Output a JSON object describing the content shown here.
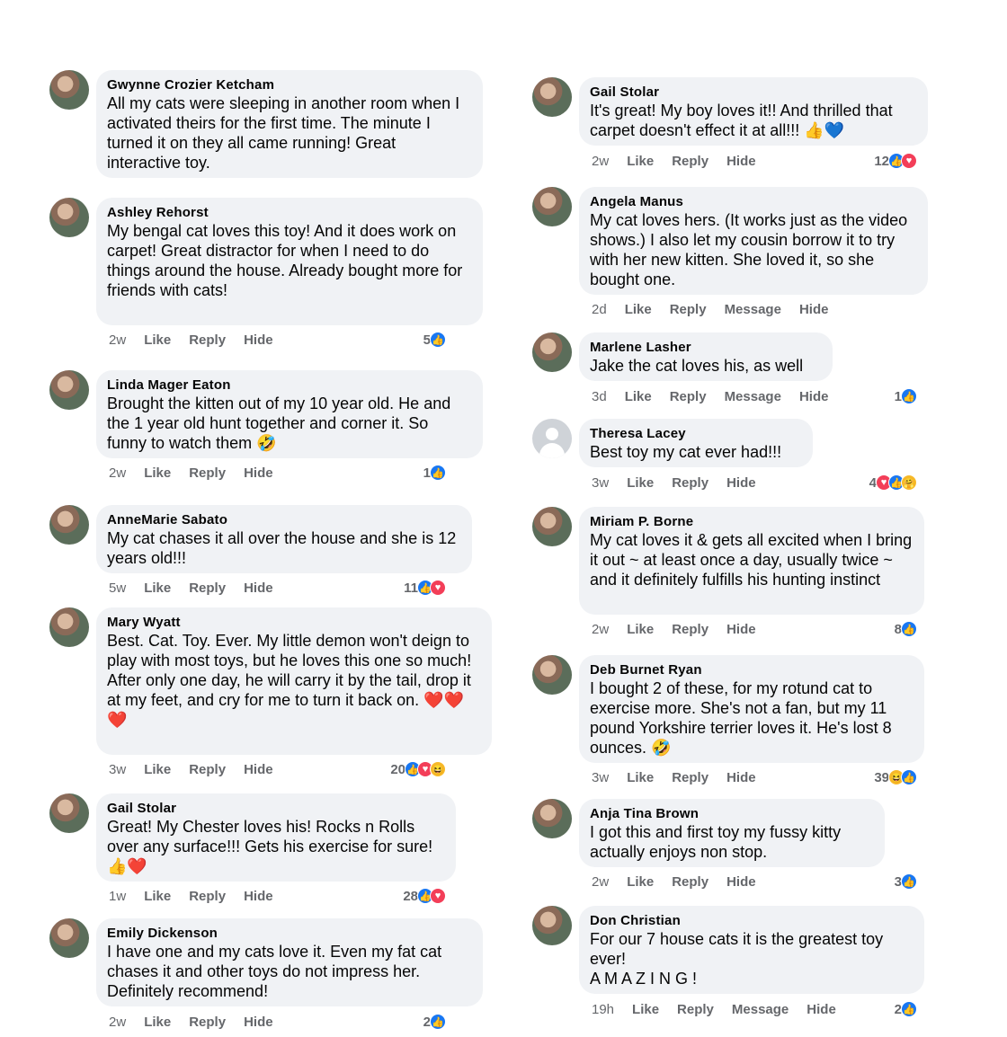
{
  "left": [
    {
      "name": "Gwynne Crozier Ketcham",
      "text": "All my cats were sleeping in another room when I activated theirs for the first time. The minute I turned it on they all came running! Great interactive toy.",
      "time": "",
      "actions": [],
      "count": "",
      "reactions": []
    },
    {
      "name": "Ashley Rehorst",
      "text": "My bengal cat loves this toy! And it does work on carpet! Great distractor for when I need to do things around the house. Already bought more for friends with cats!",
      "time": "2w",
      "actions": [
        "Like",
        "Reply",
        "Hide"
      ],
      "count": "5",
      "reactions": [
        "like"
      ]
    },
    {
      "name": "Linda Mager Eaton",
      "text": "Brought the kitten out of my 10 year old. He and the 1 year old hunt together and corner it.  So funny to watch them 🤣",
      "time": "2w",
      "actions": [
        "Like",
        "Reply",
        "Hide"
      ],
      "count": "1",
      "reactions": [
        "like"
      ]
    },
    {
      "name": "AnneMarie Sabato",
      "text": "My cat chases it all over the house and she is 12 years old!!!",
      "time": "5w",
      "actions": [
        "Like",
        "Reply",
        "Hide"
      ],
      "count": "11",
      "reactions": [
        "like",
        "love"
      ]
    },
    {
      "name": "Mary Wyatt",
      "text": "Best. Cat. Toy. Ever. My little demon won't deign to play with most toys, but he loves this one so much! After only one day, he will carry it by the tail, drop it at my feet, and cry for me to turn it back on. ❤️❤️❤️",
      "time": "3w",
      "actions": [
        "Like",
        "Reply",
        "Hide"
      ],
      "count": "20",
      "reactions": [
        "like",
        "love",
        "haha"
      ]
    },
    {
      "name": "Gail Stolar",
      "text": "Great! My Chester loves his!  Rocks n Rolls over any surface!!!  Gets his exercise for sure!👍❤️",
      "time": "1w",
      "actions": [
        "Like",
        "Reply",
        "Hide"
      ],
      "count": "28",
      "reactions": [
        "like",
        "love"
      ]
    },
    {
      "name": "Emily Dickenson",
      "text": "I have one and my cats love it. Even my fat cat chases it and other toys do not impress her. Definitely recommend!",
      "time": "2w",
      "actions": [
        "Like",
        "Reply",
        "Hide"
      ],
      "count": "2",
      "reactions": [
        "like"
      ]
    }
  ],
  "right": [
    {
      "name": "Gail Stolar",
      "text": "It's great! My boy loves it!! And thrilled that carpet doesn't effect it at all!!! 👍💙",
      "time": "2w",
      "actions": [
        "Like",
        "Reply",
        "Hide"
      ],
      "count": "12",
      "reactions": [
        "like",
        "love"
      ]
    },
    {
      "name": "Angela Manus",
      "text": "My cat loves hers. (It works just as the video shows.) I also let my cousin borrow it to try with her new kitten. She loved it, so she bought one.",
      "time": "2d",
      "actions": [
        "Like",
        "Reply",
        "Message",
        "Hide"
      ],
      "count": "",
      "reactions": []
    },
    {
      "name": "Marlene Lasher",
      "text": "Jake the cat loves his, as well",
      "time": "3d",
      "actions": [
        "Like",
        "Reply",
        "Message",
        "Hide"
      ],
      "count": "1",
      "reactions": [
        "like"
      ]
    },
    {
      "name": "Theresa Lacey",
      "text": "Best toy my cat ever had!!!",
      "time": "3w",
      "actions": [
        "Like",
        "Reply",
        "Hide"
      ],
      "count": "4",
      "reactions": [
        "love",
        "like",
        "care"
      ]
    },
    {
      "name": "Miriam P. Borne",
      "text": "My cat loves it  & gets all excited when I bring it out  ~ at least once a day, usually twice ~ and it definitely fulfills his hunting instinct",
      "time": "2w",
      "actions": [
        "Like",
        "Reply",
        "Hide"
      ],
      "count": "8",
      "reactions": [
        "like"
      ]
    },
    {
      "name": "Deb Burnet Ryan",
      "text": "I bought 2 of these, for my rotund cat to exercise more. She's not a fan, but my 11 pound Yorkshire terrier loves it. He's lost 8 ounces. 🤣",
      "time": "3w",
      "actions": [
        "Like",
        "Reply",
        "Hide"
      ],
      "count": "39",
      "reactions": [
        "haha",
        "like"
      ]
    },
    {
      "name": "Anja Tina Brown",
      "text": "I got this and first toy my fussy kitty actually enjoys non stop.",
      "time": "2w",
      "actions": [
        "Like",
        "Reply",
        "Hide"
      ],
      "count": "3",
      "reactions": [
        "like"
      ]
    },
    {
      "name": "Don Christian",
      "text": "For our 7 house cats it is the greatest toy ever!\nA M A Z I N G !",
      "time": "19h",
      "actions": [
        "Like",
        "Reply",
        "Message",
        "Hide"
      ],
      "count": "2",
      "reactions": [
        "like"
      ]
    }
  ],
  "colors": {
    "bubble": "#f0f2f5",
    "like": "#1877f2",
    "love": "#f33e58",
    "haha": "#f7b928",
    "muted": "#65676b"
  },
  "icons": {
    "like": "like-reaction-icon",
    "love": "love-reaction-icon",
    "haha": "haha-reaction-icon",
    "care": "care-reaction-icon",
    "avatar_default": "default-avatar-icon"
  }
}
